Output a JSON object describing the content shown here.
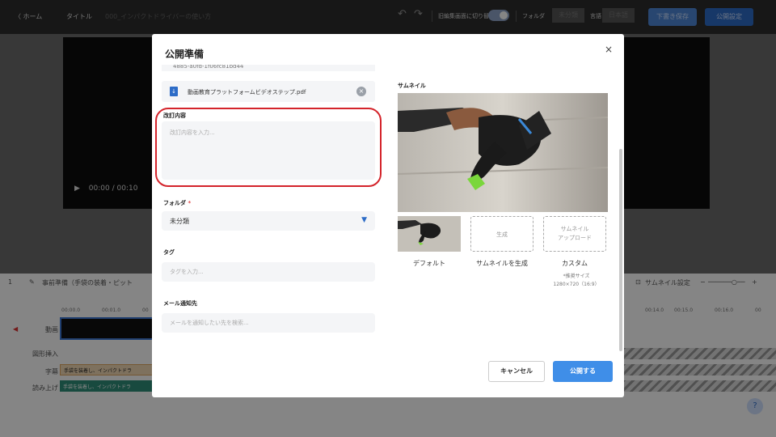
{
  "topbar": {
    "home": "〈 ホーム",
    "title_label": "タイトル",
    "title_value": "000_インパクトドライバーの使い方",
    "switch_label": "旧編集画面に切り替え",
    "folder_label": "フォルダ",
    "folder_value": "未分類",
    "lang_label": "言語",
    "lang_value": "日本語",
    "draft_button": "下書き保存",
    "publish_settings_button": "公開設定"
  },
  "player": {
    "time": "00:00 / 00:10"
  },
  "editor_toolbar": {
    "index": "1",
    "step_title": "事前準備（手袋の装着・ピット",
    "thumbnail_settings": "サムネイル設定"
  },
  "timeline": {
    "ruler_left": [
      "00:00.0",
      "00:01.0",
      "00"
    ],
    "ruler_right": [
      "00:14.0",
      "00:15.0",
      "00:16.0",
      "00"
    ],
    "tracks": {
      "video": "動画",
      "shape": "図形挿入",
      "subtitle": "字幕",
      "narration": "読み上げ"
    },
    "subtitle_clip": "手袋を装着し、インパクトドラ",
    "narration_clip": "手袋を装着し、インパクトドラ"
  },
  "modal": {
    "title": "公開準備",
    "close": "×",
    "file_top": "4885-a0fd-1f06fc81bd44",
    "attachment_name": "動画教育プラットフォームビデオステップ.pdf",
    "revision_label": "改訂内容",
    "revision_placeholder": "改訂内容を入力...",
    "folder_label": "フォルダ",
    "folder_required": "*",
    "folder_value": "未分類",
    "tag_label": "タグ",
    "tag_placeholder": "タグを入力...",
    "mail_label": "メール通知先",
    "mail_placeholder": "メールを通知したい先を検索...",
    "thumbnail_label": "サムネイル",
    "generate_box": "生成",
    "upload_box_line1": "サムネイル",
    "upload_box_line2": "アップロード",
    "option_default": "デフォルト",
    "option_generate": "サムネイルを生成",
    "option_custom": "カスタム",
    "note_line1": "*推奨サイズ",
    "note_line2": "1280×720（16:9）",
    "cancel_button": "キャンセル",
    "publish_button": "公開する"
  },
  "colors": {
    "accent": "#3f8ee8",
    "highlight": "#d4242b",
    "required": "#e14b4b"
  }
}
